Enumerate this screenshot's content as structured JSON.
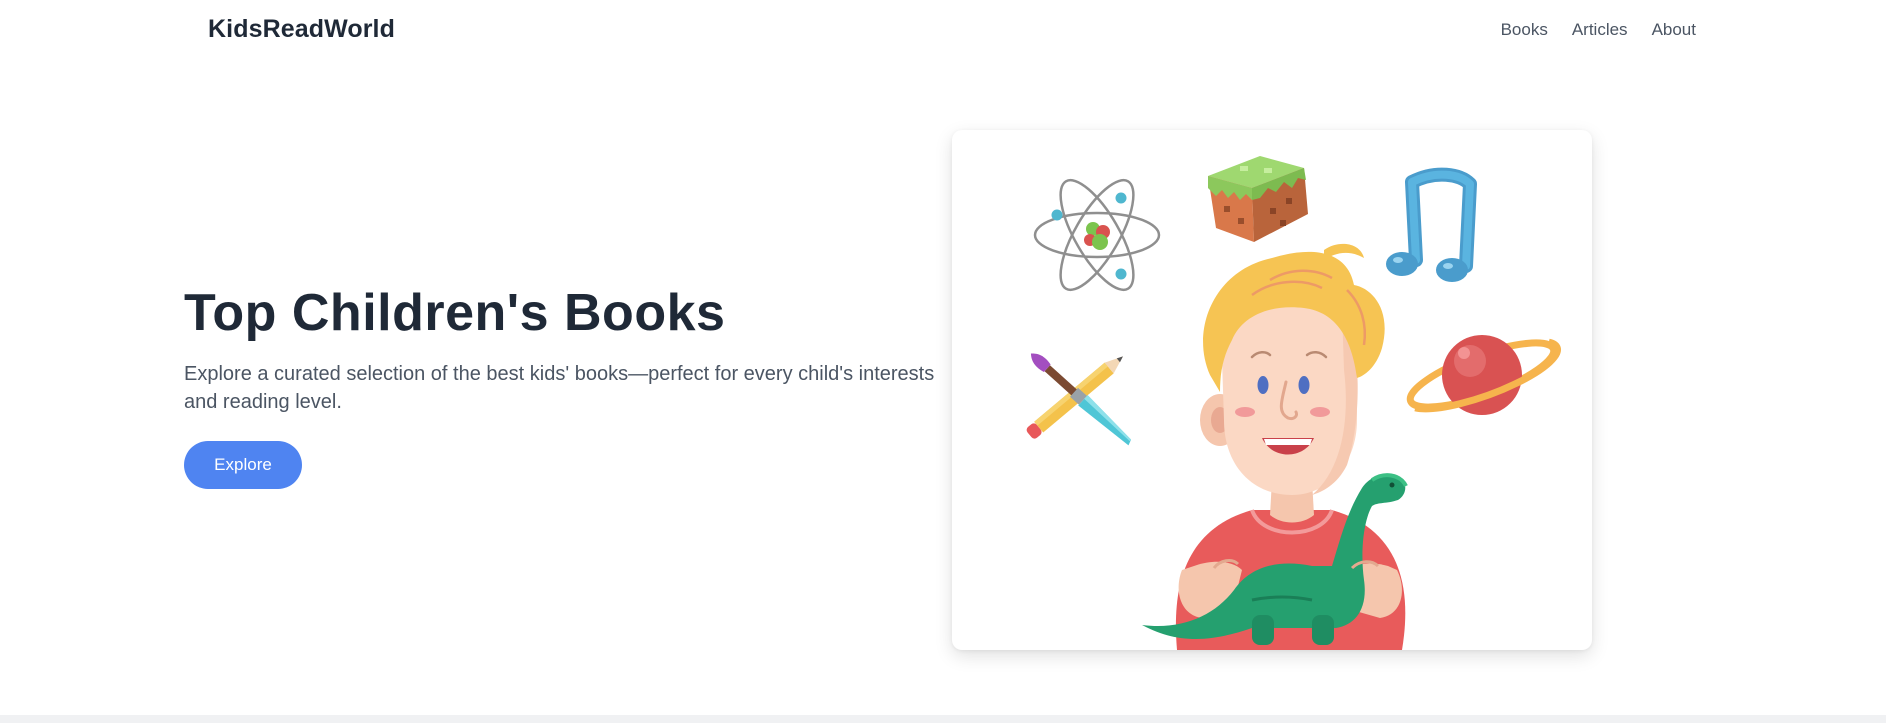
{
  "header": {
    "brand": "KidsReadWorld",
    "nav": [
      {
        "label": "Books"
      },
      {
        "label": "Articles"
      },
      {
        "label": "About"
      }
    ]
  },
  "hero": {
    "title": "Top Children's Books",
    "subtitle": "Explore a curated selection of the best kids' books—perfect for every child's interests and reading level.",
    "button_label": "Explore"
  },
  "illustration": {
    "icons": [
      "atom-icon",
      "grass-block-icon",
      "music-note-icon",
      "pencil-brush-icon",
      "planet-icon",
      "boy-with-dinosaur-illustration"
    ]
  },
  "colors": {
    "accent": "#4f84f1",
    "text_dark": "#1f2937",
    "text_muted": "#4b5563"
  }
}
